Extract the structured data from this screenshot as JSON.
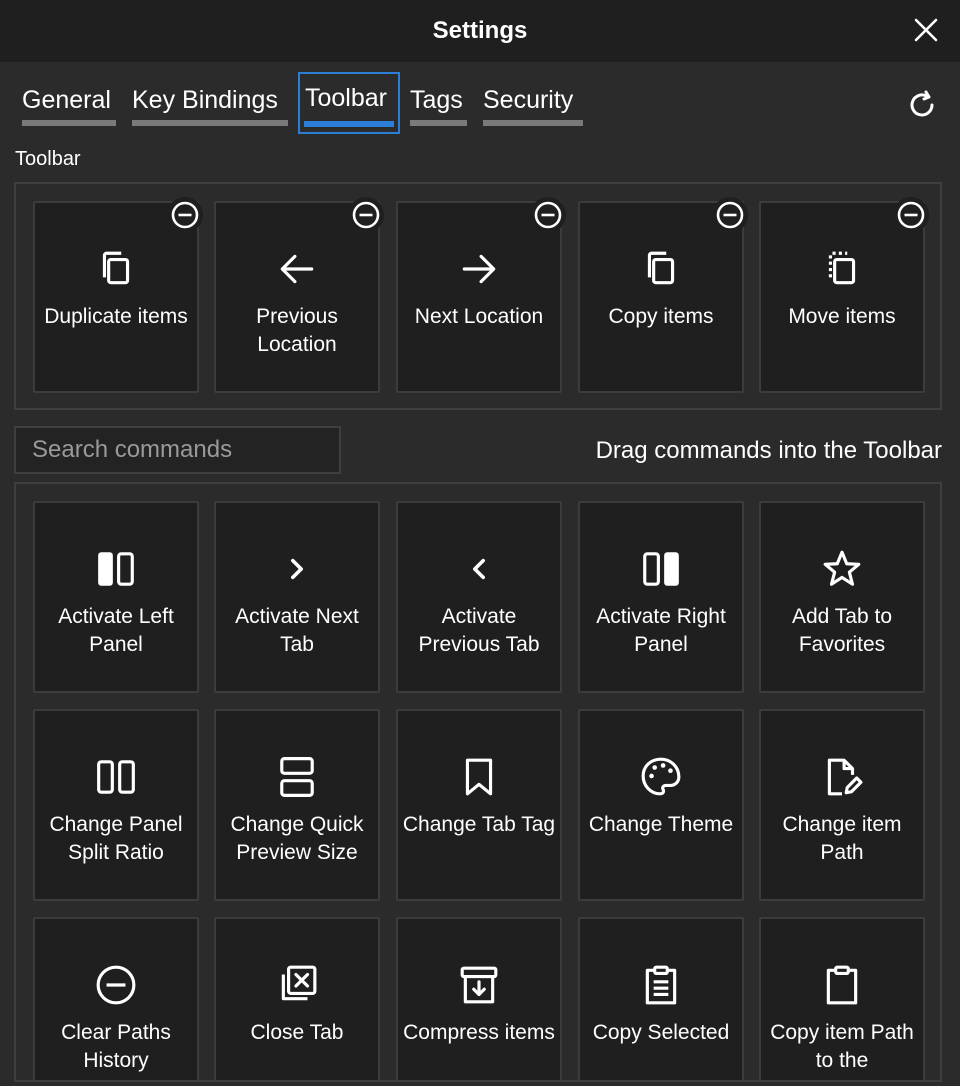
{
  "window": {
    "title": "Settings"
  },
  "tabs": [
    {
      "label": "General"
    },
    {
      "label": "Key Bindings"
    },
    {
      "label": "Toolbar"
    },
    {
      "label": "Tags"
    },
    {
      "label": "Security"
    }
  ],
  "active_tab": "Toolbar",
  "toolbar_section": {
    "label": "Toolbar",
    "items": [
      {
        "label": "Duplicate items",
        "icon": "duplicate-icon"
      },
      {
        "label": "Previous Location",
        "icon": "arrow-left-icon"
      },
      {
        "label": "Next Location",
        "icon": "arrow-right-icon"
      },
      {
        "label": "Copy items",
        "icon": "copy-icon"
      },
      {
        "label": "Move items",
        "icon": "move-icon"
      }
    ]
  },
  "search": {
    "placeholder": "Search commands",
    "value": ""
  },
  "hint": "Drag commands into the Toolbar",
  "commands": [
    {
      "label": "Activate Left Panel",
      "icon": "left-panel-icon"
    },
    {
      "label": "Activate Next Tab",
      "icon": "chevron-right-icon"
    },
    {
      "label": "Activate Previous Tab",
      "icon": "chevron-left-icon"
    },
    {
      "label": "Activate Right Panel",
      "icon": "right-panel-icon"
    },
    {
      "label": "Add Tab to Favorites",
      "icon": "star-icon"
    },
    {
      "label": "Change Panel Split Ratio",
      "icon": "split-ratio-icon"
    },
    {
      "label": "Change Quick Preview Size",
      "icon": "preview-size-icon"
    },
    {
      "label": "Change Tab Tag",
      "icon": "bookmark-icon"
    },
    {
      "label": "Change Theme",
      "icon": "palette-icon"
    },
    {
      "label": "Change item Path",
      "icon": "file-edit-icon"
    },
    {
      "label": "Clear Paths History",
      "icon": "minus-circle-icon"
    },
    {
      "label": "Close Tab",
      "icon": "close-tab-icon"
    },
    {
      "label": "Compress items",
      "icon": "archive-icon"
    },
    {
      "label": "Copy Selected",
      "icon": "clipboard-list-icon"
    },
    {
      "label": "Copy item Path to the",
      "icon": "clipboard-icon"
    }
  ],
  "colors": {
    "accent": "#2c7fd8",
    "background": "#2b2b2b",
    "card": "#1f1f1f",
    "titlebar": "#1f1f1f"
  }
}
